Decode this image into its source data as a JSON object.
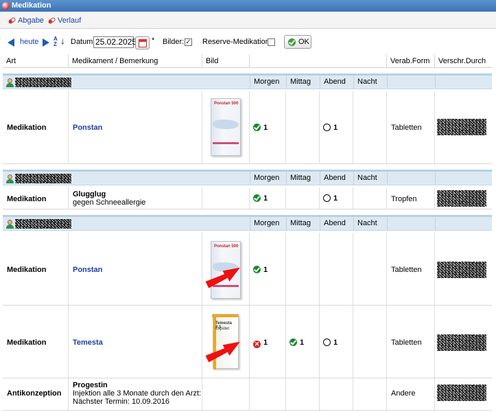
{
  "window": {
    "title": "Medikation"
  },
  "toolbar": {
    "abgabe": "Abgabe",
    "verlauf": "Verlauf"
  },
  "filter": {
    "today": "heute",
    "date_label": "Datum:",
    "date_value": "25.02.2025",
    "date_required": "*",
    "images_label": "Bilder:",
    "images_checked": "✓",
    "reserve_label": "Reserve-Medikation:",
    "ok": "OK"
  },
  "columns": {
    "art": "Art",
    "medikament": "Medikament / Bemerkung",
    "bild": "Bild",
    "verab": "Verab.Form",
    "verschr": "Verschr.Durch"
  },
  "times": {
    "morgen": "Morgen",
    "mittag": "Mittag",
    "abend": "Abend",
    "nacht": "Nacht"
  },
  "colors": {
    "title_bar": "#3c74b3",
    "group_bar": "#dce9f3",
    "link": "#1a3fa8",
    "given": "#178a2e",
    "not_given": "#dd2222",
    "arrow": "#ee1111"
  },
  "groups": [
    {
      "rows": [
        {
          "art": "Medikation",
          "name": "Ponstan",
          "morgen": "1",
          "abend": "1",
          "form": "Tabletten"
        }
      ]
    },
    {
      "rows": [
        {
          "art": "Medikation",
          "name": "Glugglug",
          "note": "gegen Schneeallergie",
          "morgen": "1",
          "abend": "1",
          "form": "Tropfen"
        }
      ]
    },
    {
      "rows": [
        {
          "art": "Medikation",
          "name": "Ponstan",
          "morgen": "1",
          "form": "Tabletten"
        },
        {
          "art": "Medikation",
          "name": "Temesta",
          "morgen": "1",
          "mittag": "1",
          "abend": "1",
          "form": "Tabletten"
        },
        {
          "art": "Antikonzeption",
          "name": "Progestin",
          "note1": "Injektion alle 3 Monate durch den Arzt:",
          "note2": "Nächster Termin: 10.09.2016",
          "form": "Andere"
        }
      ]
    }
  ],
  "images": {
    "ponstan": "Ponstan 500",
    "temesta": "Temesta 2.5",
    "temesta_sub": "Expidet"
  }
}
